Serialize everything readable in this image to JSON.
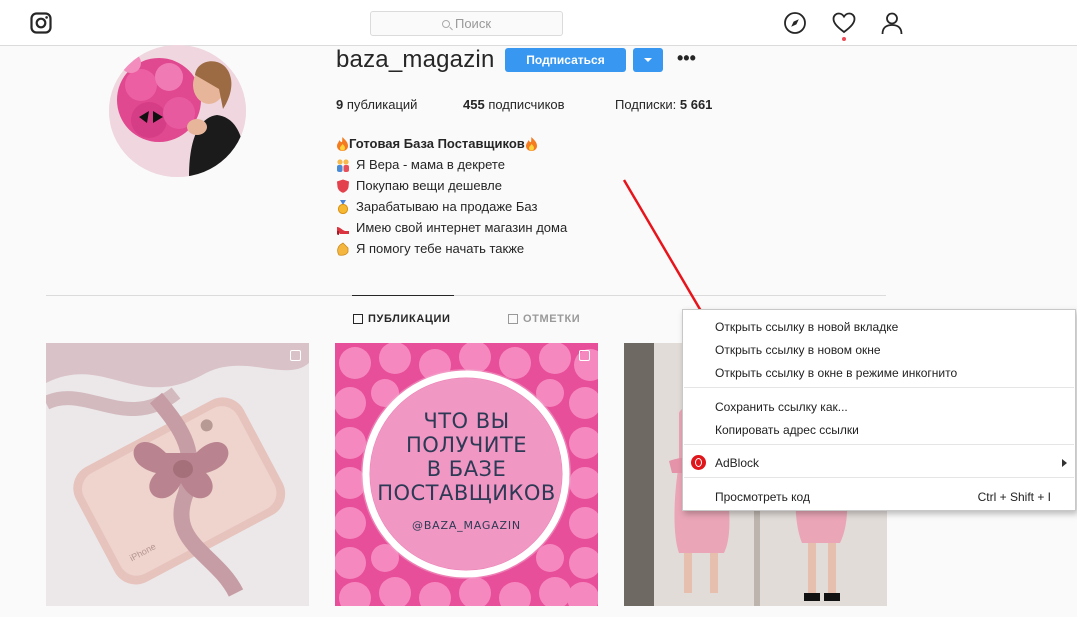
{
  "nav": {
    "search_placeholder": "Поиск",
    "icons": [
      "instagram-logo",
      "explore-compass-icon",
      "activity-heart-icon",
      "profile-user-icon"
    ]
  },
  "profile": {
    "username": "baza_magazin",
    "follow_label": "Подписаться",
    "more_label": "•••",
    "stats": {
      "posts_count": "9",
      "posts_label": "публикаций",
      "followers_count": "455",
      "followers_label": "подписчиков",
      "following_label": "Подписки:",
      "following_count": "5 661"
    },
    "bio": {
      "title": "Готовая База Поставщиков",
      "lines": [
        "Я Вера - мама в декрете",
        "Покупаю вещи дешевле",
        "Зарабатываю на продаже Баз",
        "Имею свой интернет магазин дома",
        "Я помогу тебе начать также"
      ]
    }
  },
  "tabs": {
    "publications": "ПУБЛИКАЦИИ",
    "tagged": "ОТМЕТКИ"
  },
  "posts": {
    "post2_text_lines": [
      "ЧТО ВЫ",
      "ПОЛУЧИТЕ",
      "В БАЗЕ",
      "ПОСТАВЩИКОВ"
    ],
    "post2_handle": "@BAZA_MAGAZIN"
  },
  "context_menu": {
    "open_new_tab": "Открыть ссылку в новой вкладке",
    "open_new_window": "Открыть ссылку в новом окне",
    "open_incognito": "Открыть ссылку в окне в режиме инкогнито",
    "save_link": "Сохранить ссылку как...",
    "copy_link": "Копировать адрес ссылки",
    "adblock": "AdBlock",
    "view_code": "Просмотреть код",
    "view_code_shortcut": "Ctrl + Shift + I"
  },
  "colors": {
    "accent_blue": "#3897f0",
    "annotation_red": "#e8141b"
  }
}
